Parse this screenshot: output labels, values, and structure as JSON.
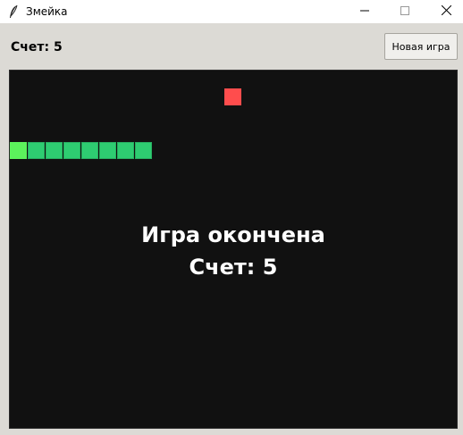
{
  "window": {
    "title": "Змейка",
    "icon": "feather-icon",
    "controls": [
      "minimize-icon",
      "maximize-icon",
      "close-icon"
    ]
  },
  "toolbar": {
    "score_text": "Счет: 5",
    "new_game_label": "Новая игра"
  },
  "game": {
    "over_title": "Игра окончена",
    "over_score": "Счет: 5",
    "score": 5,
    "colors": {
      "background": "#111111",
      "snake_head": "#5cf25c",
      "snake_body": "#2ecc71",
      "food": "#ff4d4d",
      "text": "#ffffff"
    }
  }
}
